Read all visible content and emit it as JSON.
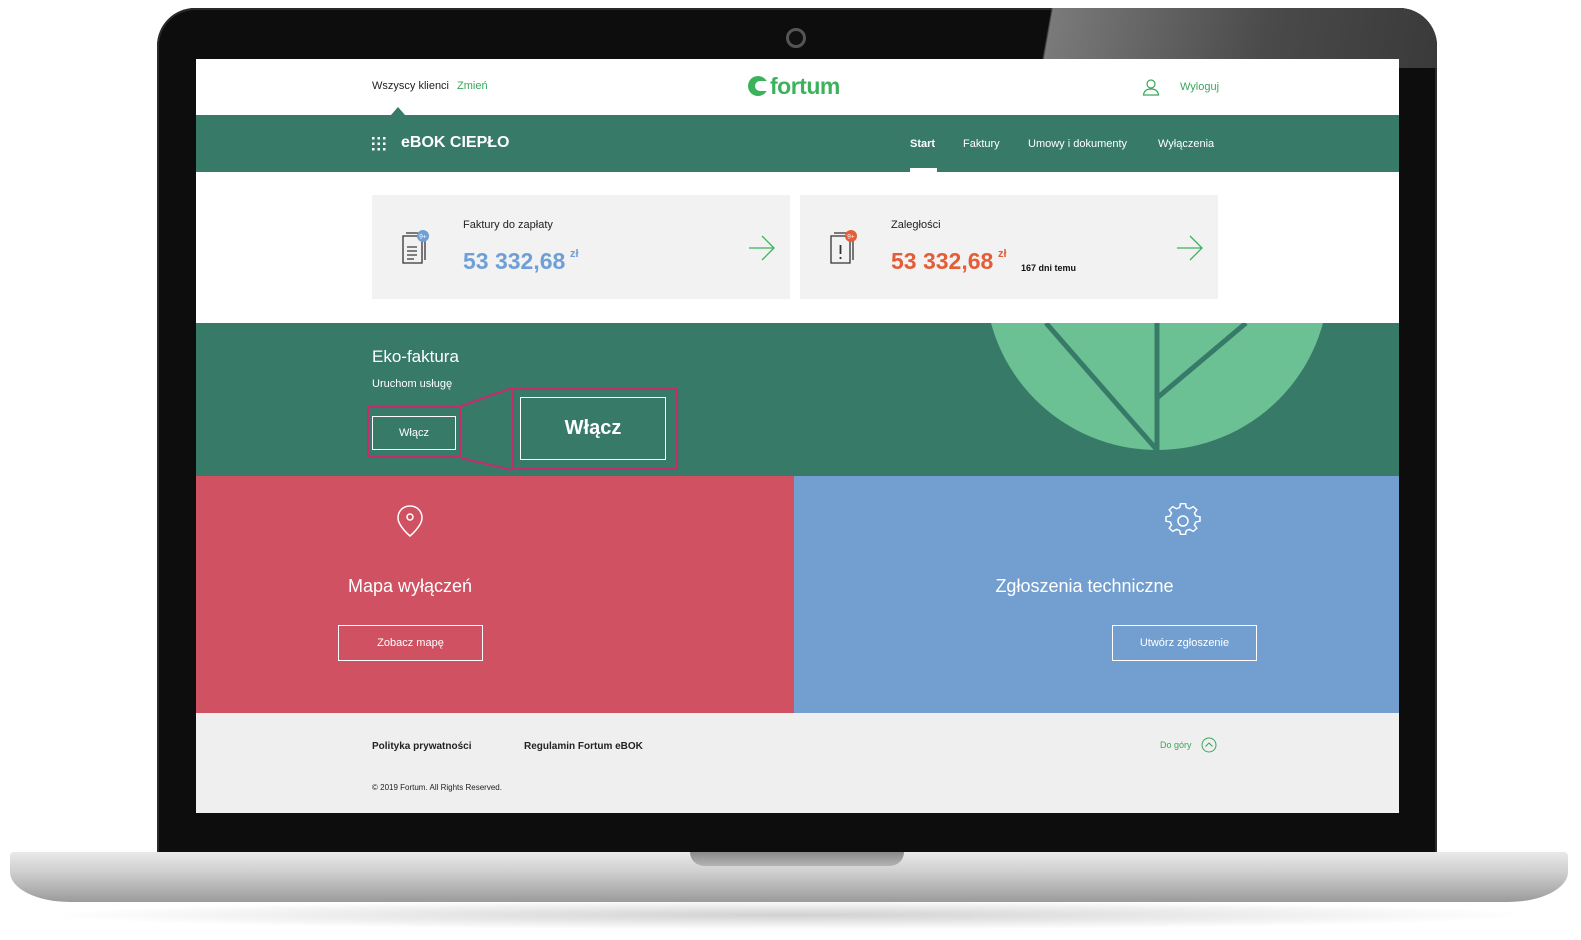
{
  "header": {
    "clients_label": "Wszyscy klienci",
    "change_link": "Zmień",
    "logo_text": "fortum",
    "logout_label": "Wyloguj"
  },
  "nav": {
    "app_title": "eBOK CIEPŁO",
    "items": [
      {
        "label": "Start",
        "active": true
      },
      {
        "label": "Faktury",
        "active": false
      },
      {
        "label": "Umowy i dokumenty",
        "active": false
      },
      {
        "label": "Wyłączenia",
        "active": false
      }
    ]
  },
  "cards": [
    {
      "label": "Faktury do zapłaty",
      "amount": "53 332,68",
      "currency": "zł",
      "badge": "9+",
      "days": "",
      "accent": "#6e9fd6"
    },
    {
      "label": "Zaległości",
      "amount": "53 332,68",
      "currency": "zł",
      "badge": "9+",
      "days": "167 dni temu",
      "accent": "#e35d37"
    }
  ],
  "eko": {
    "title": "Eko-faktura",
    "subtitle": "Uruchom usługę",
    "button_label": "Włącz",
    "button_label_zoomed": "Włącz"
  },
  "tiles": {
    "map": {
      "title": "Mapa wyłączeń",
      "button": "Zobacz mapę",
      "icon": "map-pin-icon",
      "color": "#d05162"
    },
    "tech": {
      "title": "Zgłoszenia techniczne",
      "button": "Utwórz zgłoszenie",
      "icon": "gear-icon",
      "color": "#729fd0"
    }
  },
  "footer": {
    "privacy": "Polityka prywatności",
    "terms": "Regulamin Fortum eBOK",
    "to_top": "Do góry",
    "copyright": "© 2019 Fortum. All Rights Reserved."
  },
  "colors": {
    "brand_green": "#3db25c",
    "nav_green": "#387a68",
    "highlight": "#c62c6b"
  }
}
